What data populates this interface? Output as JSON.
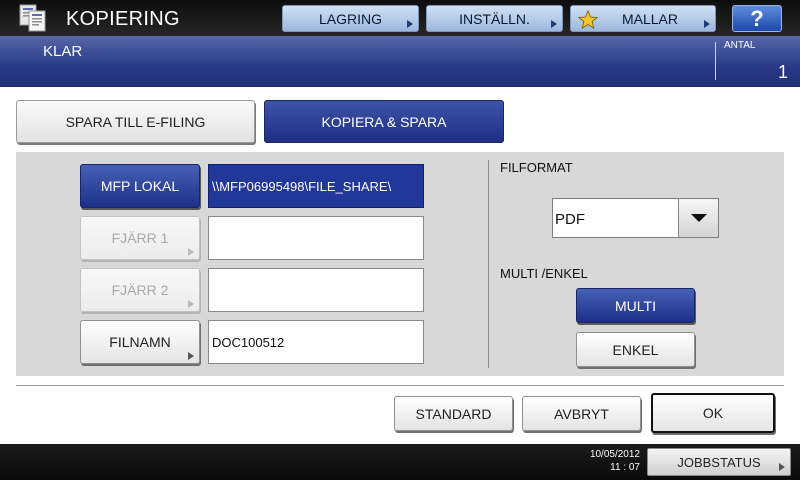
{
  "header": {
    "title": "KOPIERING",
    "icon": "copy-document-icon",
    "buttons": {
      "lagring": "LAGRING",
      "installn": "INSTÄLLN.",
      "mallar": "MALLAR",
      "help": "?"
    }
  },
  "status": {
    "message": "KLAR",
    "count_label": "ANTAL",
    "count_value": "1"
  },
  "tabs": {
    "spara_efiling": "SPARA TILL E-FILING",
    "kopiera_spara": "KOPIERA & SPARA"
  },
  "destinations": {
    "mfp_local": {
      "label": "MFP LOKAL",
      "path": "\\\\MFP06995498\\FILE_SHARE\\"
    },
    "remote1": {
      "label": "FJÄRR 1",
      "path": ""
    },
    "remote2": {
      "label": "FJÄRR 2",
      "path": ""
    },
    "filename": {
      "label": "FILNAMN",
      "value": "DOC100512"
    }
  },
  "file_format": {
    "label": "FILFORMAT",
    "selected": "PDF"
  },
  "multi_single": {
    "label": "MULTI /ENKEL",
    "multi": "MULTI",
    "single": "ENKEL"
  },
  "actions": {
    "standard": "STANDARD",
    "cancel": "AVBRYT",
    "ok": "OK"
  },
  "footer": {
    "date": "10/05/2012",
    "time": "11 : 07",
    "jobstatus": "JOBBSTATUS"
  },
  "colors": {
    "accent_blue": "#22379a",
    "status_bar": "#2a3a86",
    "panel_gray": "#d8d8d8"
  }
}
